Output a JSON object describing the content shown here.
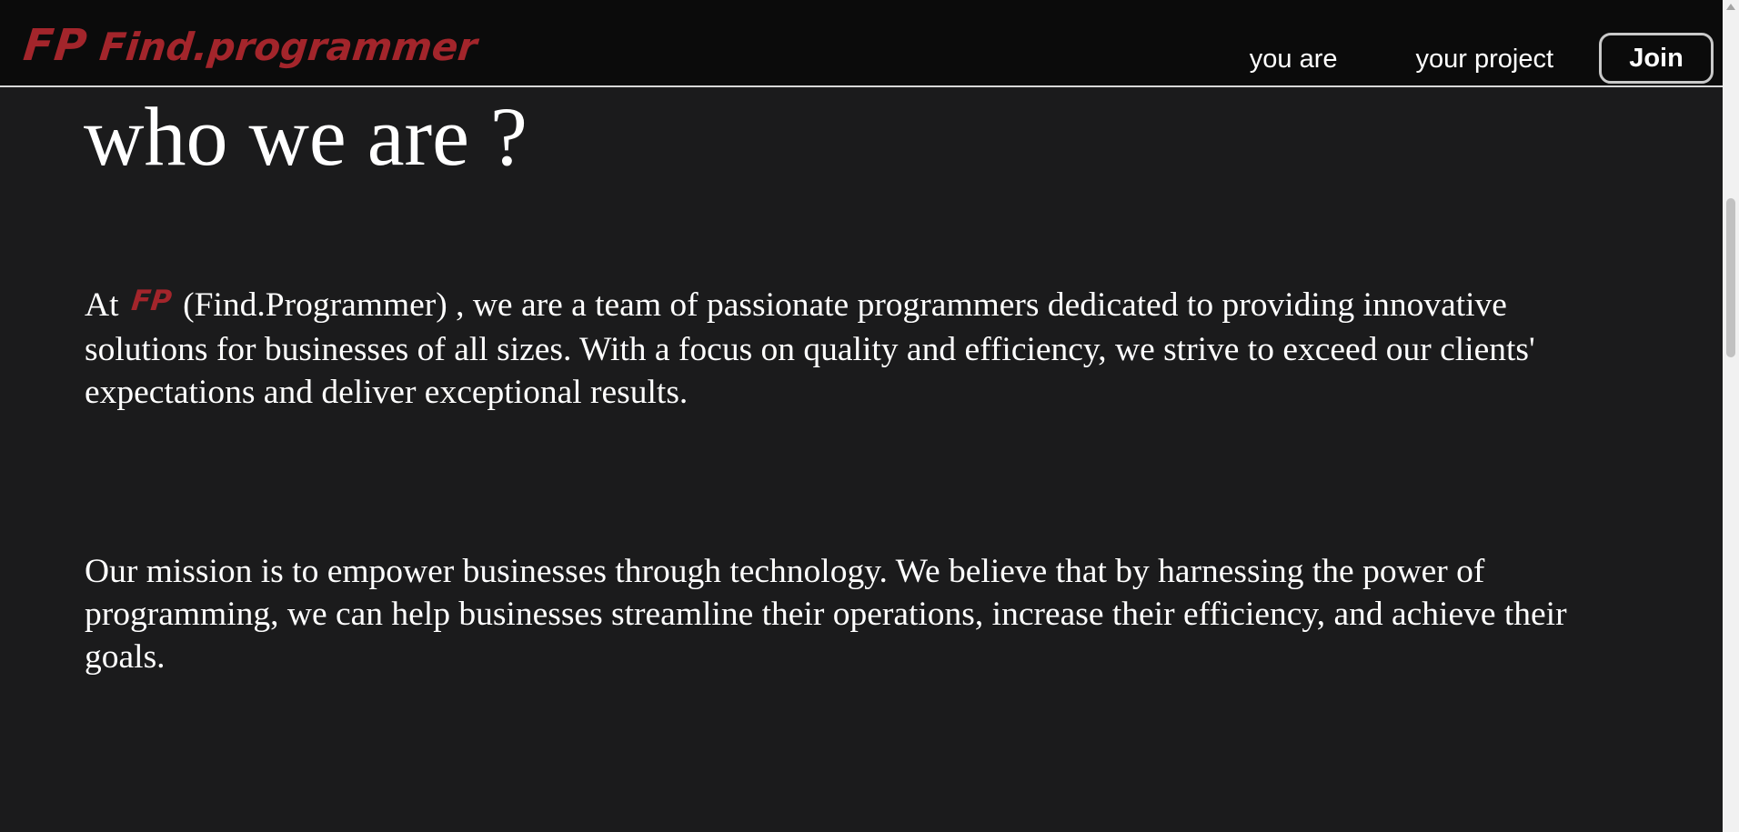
{
  "header": {
    "logo_mark": "FP",
    "logo_name": "Find.programmer",
    "nav": [
      {
        "label": "you are"
      },
      {
        "label": "your project"
      }
    ],
    "join_label": "Join"
  },
  "main": {
    "title": "who we are ?",
    "para1": {
      "before": "At",
      "logo_inline": "FP",
      "after": "(Find.Programmer) , we are a team of passionate programmers dedicated to providing innovative solutions for businesses of all sizes. With a focus on quality and efficiency, we strive to exceed our clients' expectations and deliver exceptional results."
    },
    "para2": "Our mission is to empower businesses through technology. We believe that by harnessing the power of programming, we can help businesses streamline their operations, increase their efficiency, and achieve their goals."
  },
  "colors": {
    "brand": "#a3252b",
    "background": "#1b1b1c",
    "header_bg": "#0b0b0b",
    "text": "#ffffff"
  },
  "icons": {
    "scroll_up": "triangle-up-icon"
  }
}
